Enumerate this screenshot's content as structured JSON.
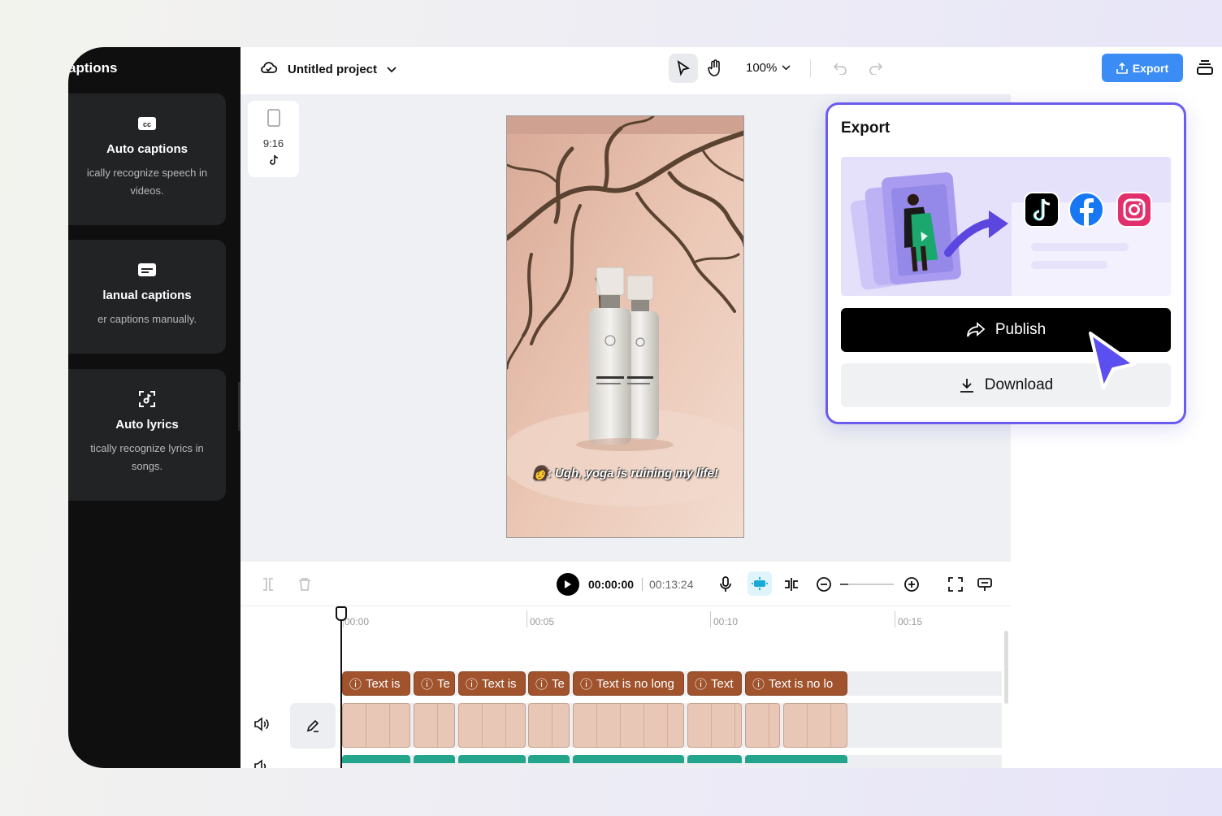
{
  "left_panel": {
    "title": "aptions",
    "cards": [
      {
        "icon": "cc-icon",
        "title": "Auto captions",
        "desc_line1": "ically recognize speech in",
        "desc_line2": "videos."
      },
      {
        "icon": "subtitle-icon",
        "title": "lanual captions",
        "desc_line1": "er captions manually.",
        "desc_line2": ""
      },
      {
        "icon": "lyrics-icon",
        "title": "Auto lyrics",
        "desc_line1": "tically recognize lyrics in",
        "desc_line2": "songs."
      }
    ]
  },
  "topbar": {
    "project_name": "Untitled project",
    "zoom": "100%",
    "export_label": "Export"
  },
  "canvas": {
    "ratio_label": "9:16",
    "video_caption": "👩: Ugh, yoga is ruining my life!"
  },
  "export_popover": {
    "title": "Export",
    "publish_label": "Publish",
    "download_label": "Download",
    "social_icons": [
      "tiktok-icon",
      "facebook-icon",
      "instagram-icon"
    ]
  },
  "timeline": {
    "current_time": "00:00:00",
    "total_time": "00:13:24",
    "ticks": [
      "00:00",
      "00:05",
      "00:10",
      "00:15"
    ],
    "caption_clips": [
      "Text is",
      "Te",
      "Text is",
      "Te",
      "Text is no long",
      "Text",
      "Text is no lo"
    ]
  },
  "colors": {
    "accent": "#3b8df5",
    "popover_border": "#6b5cf0",
    "caption_clip": "#a0532d",
    "audio_clip": "#23a58c"
  }
}
